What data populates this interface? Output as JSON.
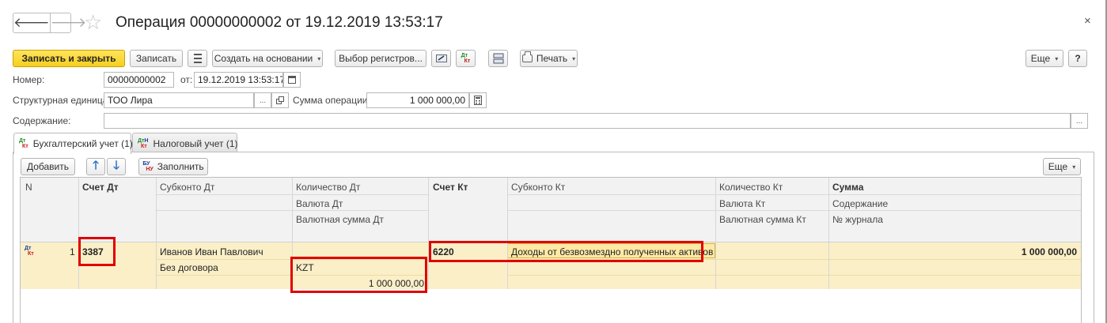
{
  "window": {
    "title": "Операция 00000000002 от 19.12.2019 13:53:17",
    "back_glyph": "🡐",
    "forward_glyph": "🡒",
    "star_glyph": "☆",
    "close_glyph": "×"
  },
  "toolbar": {
    "save_close": "Записать и закрыть",
    "save": "Записать",
    "create_based": "Создать на основании",
    "register_select": "Выбор регистров...",
    "print": "Печать",
    "more": "Еще",
    "help": "?",
    "caret": "▾",
    "dt": "Дт",
    "kt": "Кт"
  },
  "form": {
    "number_label": "Номер:",
    "number_value": "00000000002",
    "date_label": "от:",
    "date_value": "19.12.2019 13:53:17",
    "unit_label": "Структурная единица:",
    "unit_value": "ТОО Лира",
    "amount_label": "Сумма операции:",
    "amount_value": "1 000 000,00",
    "content_label": "Содержание:",
    "content_value": "",
    "ellipsis": "..."
  },
  "tabs": [
    {
      "label": "Бухгалтерский учет (1)",
      "dt": "Дт",
      "kt": "Кт"
    },
    {
      "label": "Налоговый учет (1)",
      "dt": "Дт",
      "n": "Н",
      "kt": "Кт"
    }
  ],
  "table_toolbar": {
    "add": "Добавить",
    "up": "🡑",
    "down": "🡓",
    "fill": "Заполнить",
    "bu": "БУ",
    "nu": "НУ",
    "more": "Еще"
  },
  "columns": {
    "n": "N",
    "account_dt": "Счет Дт",
    "subconto_dt": "Субконто Дт",
    "qty_dt": "Количество Дт",
    "currency_dt": "Валюта Дт",
    "cur_amount_dt": "Валютная сумма Дт",
    "account_kt": "Счет Кт",
    "subconto_kt": "Субконто Кт",
    "qty_kt": "Количество Кт",
    "currency_kt": "Валюта Кт",
    "cur_amount_kt": "Валютная сумма Кт",
    "sum": "Сумма",
    "content": "Содержание",
    "journal": "№ журнала"
  },
  "rows": [
    {
      "n": "1",
      "icon_dt": "Дт",
      "icon_kt": "Кт",
      "account_dt": "3387",
      "subconto_dt_1": "Иванов Иван Павлович",
      "subconto_dt_2": "Без договора",
      "currency_dt": "KZT",
      "cur_amount_dt": "1 000 000,00",
      "account_kt": "6220",
      "subconto_kt_1": "Доходы от безвозмездно полученных активов",
      "sum": "1 000 000,00"
    }
  ],
  "colors": {
    "primary_button": "#f6cf1e",
    "selected_row": "#fbefc8",
    "highlight_box": "#e00000"
  }
}
